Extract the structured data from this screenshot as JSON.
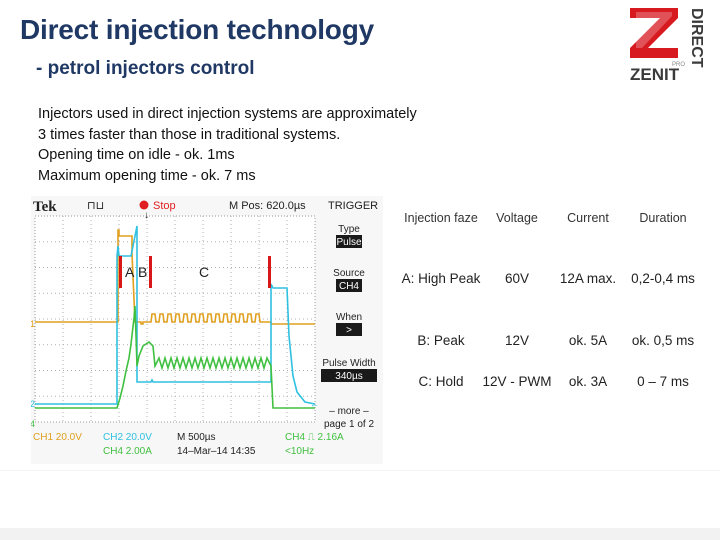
{
  "header": {
    "title": "Direct injection technology",
    "subtitle": "- petrol injectors control"
  },
  "logo": {
    "letter": "Z",
    "side_text": "DIRECT",
    "brand": "ZENIT",
    "pro": "PRO",
    "accent_color": "#d71920",
    "dark_color": "#3a3a3a"
  },
  "intro": {
    "lines": [
      "Injectors used in direct injection systems are approximately",
      "3 times faster than those in traditional systems.",
      "Opening  time on idle - ok.  1ms",
      "Maximum opening time - ok. 7 ms"
    ]
  },
  "oscilloscope": {
    "brand": "Tek",
    "run_state": "Stop",
    "m_pos": "M Pos: 620.0µs",
    "trigger_title": "TRIGGER",
    "menu": [
      {
        "label": "Type",
        "value": "Pulse"
      },
      {
        "label": "Source",
        "value": "CH4"
      },
      {
        "label": "When",
        "value": ">"
      },
      {
        "label": "Pulse Width",
        "value": "340µs"
      },
      {
        "label": "– more –",
        "value": "page 1 of 2"
      }
    ],
    "markers": [
      "A",
      "B",
      "C"
    ],
    "channel_markers": [
      "1",
      "2",
      "4"
    ],
    "status": {
      "ch1": "CH1  20.0V",
      "ch2": "CH2  20.0V",
      "ch4": "CH4  2.00A",
      "timebase": "M 500µs",
      "date": "14–Mar–14 14:35",
      "trig": "CH4  ⎍  2.16A",
      "freq": "<10Hz"
    },
    "trace_colors": {
      "ch1": "#e0a020",
      "ch2": "#30c0e0",
      "ch4": "#40c040"
    }
  },
  "table": {
    "headers": [
      "Injection faze",
      "Voltage",
      "Current",
      "Duration"
    ],
    "rows": [
      [
        "A: High Peak",
        "60V",
        "12A max.",
        "0,2-0,4 ms"
      ],
      [
        "B: Peak",
        "12V",
        "ok. 5A",
        "ok. 0,5 ms"
      ],
      [
        "C: Hold",
        "12V - PWM",
        "ok. 3A",
        "0 – 7 ms"
      ]
    ]
  }
}
